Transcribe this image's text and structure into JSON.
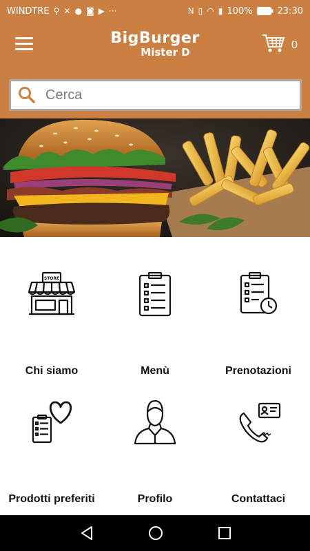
{
  "status_bar": {
    "carrier": "WINDTRE",
    "battery": "100%",
    "time": "23:30",
    "icons": [
      "usb-icon",
      "notification-icon",
      "facebook-icon",
      "instagram-icon",
      "youtube-icon",
      "more-icon",
      "nfc-icon",
      "vibrate-icon",
      "wifi-icon",
      "signal-icon",
      "battery-icon"
    ]
  },
  "header": {
    "brand_line1": "BigBurger",
    "brand_line2": "Mister D",
    "cart_count": "0",
    "accent_color": "#c98042"
  },
  "search": {
    "placeholder": "Cerca",
    "value": ""
  },
  "menu": {
    "items": [
      {
        "label": "Chi siamo",
        "icon": "store-icon"
      },
      {
        "label": "Menù",
        "icon": "clipboard-list-icon"
      },
      {
        "label": "Prenotazioni",
        "icon": "clipboard-clock-icon"
      },
      {
        "label": "Prodotti preferiti",
        "icon": "clipboard-heart-icon"
      },
      {
        "label": "Profilo",
        "icon": "user-profile-icon"
      },
      {
        "label": "Contattaci",
        "icon": "contact-phone-icon"
      }
    ]
  },
  "nav": {
    "buttons": [
      "back-icon",
      "home-icon",
      "recents-icon"
    ]
  }
}
